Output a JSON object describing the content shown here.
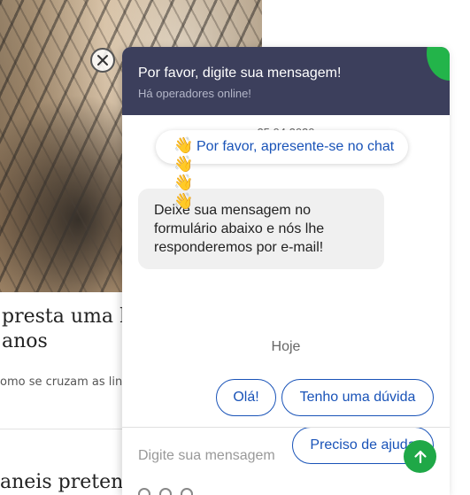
{
  "article": {
    "title_1": "presta uma h",
    "title_1_line2": "anos",
    "snippet": "omo se cruzam as linh",
    "title_2": "aneis pretend"
  },
  "chat": {
    "header_title": "Por favor, digite sua mensagem!",
    "header_subtitle": "Há operadores online!",
    "date": "25.04.2020",
    "intro_prompt": "Por favor, apresente-se no chat",
    "wave_emoji": "👋",
    "bot_message": "Deixe sua mensagem no formulário abaixo e nós lhe responderemos por e-mail!",
    "today_label": "Hoje",
    "quick_replies": [
      "Olá!",
      "Tenho uma dúvida",
      "Preciso de ajuda"
    ],
    "input_placeholder": "Digite sua mensagem",
    "colors": {
      "header_bg": "#3c3f5c",
      "online_indicator": "#23b44a",
      "accent_blue": "#1953b8",
      "send_button": "#1fa847",
      "bubble_bg": "#f0f0f0"
    },
    "icons": {
      "close": "close-icon",
      "send": "arrow-up-icon"
    }
  }
}
